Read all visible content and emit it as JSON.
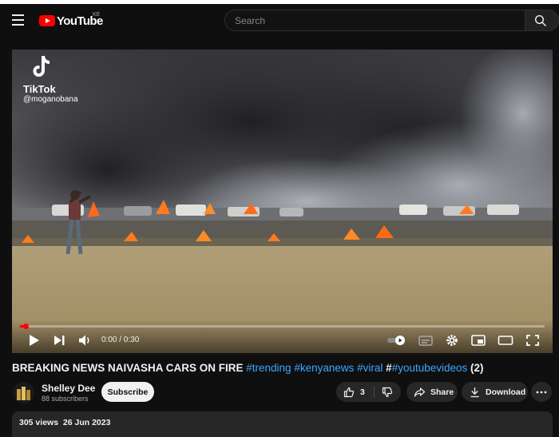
{
  "header": {
    "logo_text": "YouTube",
    "country": "KE",
    "search_placeholder": "Search"
  },
  "player": {
    "watermark_brand": "TikTok",
    "watermark_handle": "@moganobana",
    "time": "0:00 / 0:30",
    "progress_fraction": 0.01
  },
  "video": {
    "title_main": "BREAKING NEWS NAIVASHA CARS ON FIRE ",
    "hashtags": [
      "#trending",
      "#kenyanews",
      "#viral"
    ],
    "hash_prefix": " #",
    "last_hashtag": "#youtubevideos",
    "title_suffix": " (2)"
  },
  "channel": {
    "name": "Shelley Dee",
    "subscribers": "88 subscribers",
    "subscribe_label": "Subscribe"
  },
  "actions": {
    "like_count": "3",
    "share_label": "Share",
    "download_label": "Download"
  },
  "description": {
    "views": "305 views",
    "date": "26 Jun 2023"
  },
  "colors": {
    "background": "#0f0f0f",
    "accent": "#ff0000",
    "link": "#3ea6ff",
    "pill": "#272727"
  }
}
